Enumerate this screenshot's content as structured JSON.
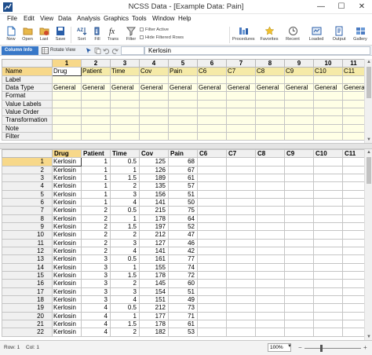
{
  "window": {
    "title": "NCSS Data - [Example Data: Pain]",
    "minimize": "—",
    "maximize": "☐",
    "close": "✕"
  },
  "menu": [
    "File",
    "Edit",
    "View",
    "Data",
    "Analysis",
    "Graphics",
    "Tools",
    "Window",
    "Help"
  ],
  "toolbar": {
    "new": "New",
    "open": "Open",
    "last": "Last",
    "save": "Save",
    "sort": "Sort",
    "fill": "Fill",
    "trans": "Trans",
    "filter": "Filter",
    "filter_active": "Filter Active",
    "hide_filtered": "Hide Filtered Rows",
    "procedures": "Procedures",
    "favorites": "Favorites",
    "recent": "Recent",
    "loaded": "Loaded",
    "output": "Output",
    "gallery": "Gallery"
  },
  "bar2": {
    "column_info": "Column Info",
    "rotate_view": "Rotate View",
    "cell_ref": "",
    "formula_value": "Kerlosin"
  },
  "column_info": {
    "col_numbers": [
      "1",
      "2",
      "3",
      "4",
      "5",
      "6",
      "7",
      "8",
      "9",
      "10",
      "11"
    ],
    "rows": [
      {
        "label": "Name",
        "values": [
          "Drug",
          "Patient",
          "Time",
          "Cov",
          "Pain",
          "C6",
          "C7",
          "C8",
          "C9",
          "C10",
          "C11"
        ]
      },
      {
        "label": "Label",
        "values": [
          "",
          "",
          "",
          "",
          "",
          "",
          "",
          "",
          "",
          "",
          ""
        ]
      },
      {
        "label": "Data Type",
        "values": [
          "General",
          "General",
          "General",
          "General",
          "General",
          "General",
          "General",
          "General",
          "General",
          "General",
          "General"
        ]
      },
      {
        "label": "Format",
        "values": [
          "",
          "",
          "",
          "",
          "",
          "",
          "",
          "",
          "",
          "",
          ""
        ]
      },
      {
        "label": "Value Labels",
        "values": [
          "",
          "",
          "",
          "",
          "",
          "",
          "",
          "",
          "",
          "",
          ""
        ]
      },
      {
        "label": "Value Order",
        "values": [
          "",
          "",
          "",
          "",
          "",
          "",
          "",
          "",
          "",
          "",
          ""
        ]
      },
      {
        "label": "Transformation",
        "values": [
          "",
          "",
          "",
          "",
          "",
          "",
          "",
          "",
          "",
          "",
          ""
        ]
      },
      {
        "label": "Note",
        "values": [
          "",
          "",
          "",
          "",
          "",
          "",
          "",
          "",
          "",
          "",
          ""
        ]
      },
      {
        "label": "Filter",
        "values": [
          "",
          "",
          "",
          "",
          "",
          "",
          "",
          "",
          "",
          "",
          ""
        ]
      }
    ]
  },
  "data_grid": {
    "headers": [
      "Drug",
      "Patient",
      "Time",
      "Cov",
      "Pain",
      "C6",
      "C7",
      "C8",
      "C9",
      "C10",
      "C11"
    ],
    "rows": [
      [
        "1",
        "Kerlosin",
        "1",
        "0.5",
        "125",
        "68"
      ],
      [
        "2",
        "Kerlosin",
        "1",
        "1",
        "126",
        "67"
      ],
      [
        "3",
        "Kerlosin",
        "1",
        "1.5",
        "189",
        "61"
      ],
      [
        "4",
        "Kerlosin",
        "1",
        "2",
        "135",
        "57"
      ],
      [
        "5",
        "Kerlosin",
        "1",
        "3",
        "156",
        "51"
      ],
      [
        "6",
        "Kerlosin",
        "1",
        "4",
        "141",
        "50"
      ],
      [
        "7",
        "Kerlosin",
        "2",
        "0.5",
        "215",
        "75"
      ],
      [
        "8",
        "Kerlosin",
        "2",
        "1",
        "178",
        "64"
      ],
      [
        "9",
        "Kerlosin",
        "2",
        "1.5",
        "197",
        "52"
      ],
      [
        "10",
        "Kerlosin",
        "2",
        "2",
        "212",
        "47"
      ],
      [
        "11",
        "Kerlosin",
        "2",
        "3",
        "127",
        "46"
      ],
      [
        "12",
        "Kerlosin",
        "2",
        "4",
        "141",
        "42"
      ],
      [
        "13",
        "Kerlosin",
        "3",
        "0.5",
        "161",
        "77"
      ],
      [
        "14",
        "Kerlosin",
        "3",
        "1",
        "155",
        "74"
      ],
      [
        "15",
        "Kerlosin",
        "3",
        "1.5",
        "178",
        "72"
      ],
      [
        "16",
        "Kerlosin",
        "3",
        "2",
        "145",
        "60"
      ],
      [
        "17",
        "Kerlosin",
        "3",
        "3",
        "154",
        "51"
      ],
      [
        "18",
        "Kerlosin",
        "3",
        "4",
        "151",
        "49"
      ],
      [
        "19",
        "Kerlosin",
        "4",
        "0.5",
        "212",
        "73"
      ],
      [
        "20",
        "Kerlosin",
        "4",
        "1",
        "177",
        "71"
      ],
      [
        "21",
        "Kerlosin",
        "4",
        "1.5",
        "178",
        "61"
      ],
      [
        "22",
        "Kerlosin",
        "4",
        "2",
        "182",
        "53"
      ]
    ]
  },
  "status": {
    "row": "Row: 1",
    "col": "Col: 1",
    "zoom": "100%",
    "zoom_minus": "−",
    "zoom_plus": "+"
  }
}
